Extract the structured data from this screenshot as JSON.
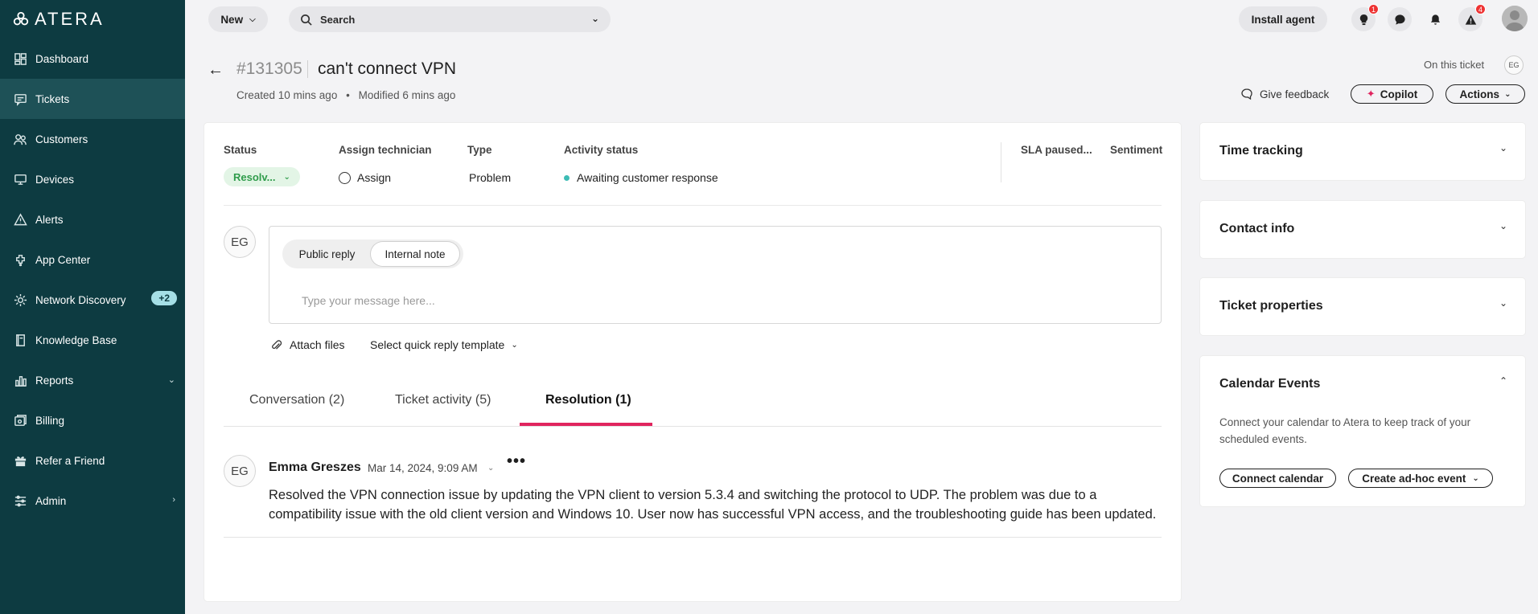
{
  "brand": {
    "name": "ATERA"
  },
  "sidebar": {
    "items": [
      {
        "label": "Dashboard",
        "icon": "dashboard-icon"
      },
      {
        "label": "Tickets",
        "icon": "tickets-icon",
        "active": true
      },
      {
        "label": "Customers",
        "icon": "customers-icon"
      },
      {
        "label": "Devices",
        "icon": "devices-icon"
      },
      {
        "label": "Alerts",
        "icon": "alerts-icon"
      },
      {
        "label": "App Center",
        "icon": "app-center-icon"
      },
      {
        "label": "Network Discovery",
        "icon": "network-discovery-icon",
        "badge": "+2"
      },
      {
        "label": "Knowledge Base",
        "icon": "knowledge-base-icon"
      },
      {
        "label": "Reports",
        "icon": "reports-icon"
      },
      {
        "label": "Billing",
        "icon": "billing-icon"
      },
      {
        "label": "Refer a Friend",
        "icon": "gift-icon"
      },
      {
        "label": "Admin",
        "icon": "admin-icon"
      }
    ]
  },
  "topbar": {
    "new_label": "New",
    "search_label": "Search",
    "install_label": "Install agent",
    "badges": {
      "tips": "1",
      "warnings": "4"
    }
  },
  "ticket": {
    "id": "#131305",
    "title": "can't connect VPN",
    "created": "Created 10 mins ago",
    "separator": "•",
    "modified": "Modified 6 mins ago",
    "on_this_ticket": "On this ticket",
    "viewer_initials": "EG",
    "feedback_label": "Give feedback",
    "copilot_label": "Copilot",
    "actions_label": "Actions"
  },
  "fields": {
    "status_label": "Status",
    "status_value": "Resolv...",
    "technician_label": "Assign technician",
    "technician_value": "Assign",
    "type_label": "Type",
    "type_value": "Problem",
    "activity_label": "Activity status",
    "activity_value": "Awaiting customer response",
    "sla_label": "SLA paused...",
    "sentiment_label": "Sentiment"
  },
  "composer": {
    "avatar": "EG",
    "public_reply": "Public reply",
    "internal_note": "Internal note",
    "placeholder": "Type your message here...",
    "attach_label": "Attach files",
    "quick_reply_label": "Select quick reply template"
  },
  "tabs": [
    {
      "label": "Conversation (2)"
    },
    {
      "label": "Ticket activity (5)"
    },
    {
      "label": "Resolution (1)",
      "active": true
    }
  ],
  "resolution": {
    "avatar": "EG",
    "author": "Emma Greszes",
    "timestamp": "Mar 14, 2024, 9:09 AM",
    "more": "•••",
    "text": "Resolved the VPN connection issue by updating the VPN client to version 5.3.4 and switching the protocol to UDP. The problem was due to a compatibility issue with the old client version and Windows 10. User now has successful VPN access, and the troubleshooting guide has been updated."
  },
  "panels": {
    "time_tracking": "Time tracking",
    "contact_info": "Contact info",
    "ticket_properties": "Ticket properties",
    "calendar": {
      "title": "Calendar Events",
      "description": "Connect your calendar to Atera to keep track of your scheduled events.",
      "connect_label": "Connect calendar",
      "adhoc_label": "Create ad-hoc event"
    }
  },
  "colors": {
    "sidebar_bg": "#0d3b41",
    "accent": "#e0245e",
    "status_green": "#2f9c4b",
    "activity_dot": "#3dbcb5"
  }
}
